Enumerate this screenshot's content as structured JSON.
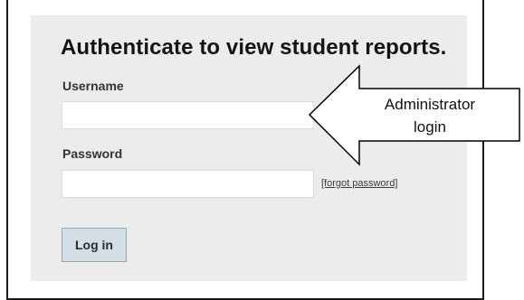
{
  "form": {
    "title": "Authenticate to view student reports.",
    "username_label": "Username",
    "username_value": "",
    "password_label": "Password",
    "password_value": "",
    "forgot_link": "[forgot password]",
    "login_button": "Log in"
  },
  "annotation": {
    "line1": "Administrator",
    "line2": "login"
  }
}
